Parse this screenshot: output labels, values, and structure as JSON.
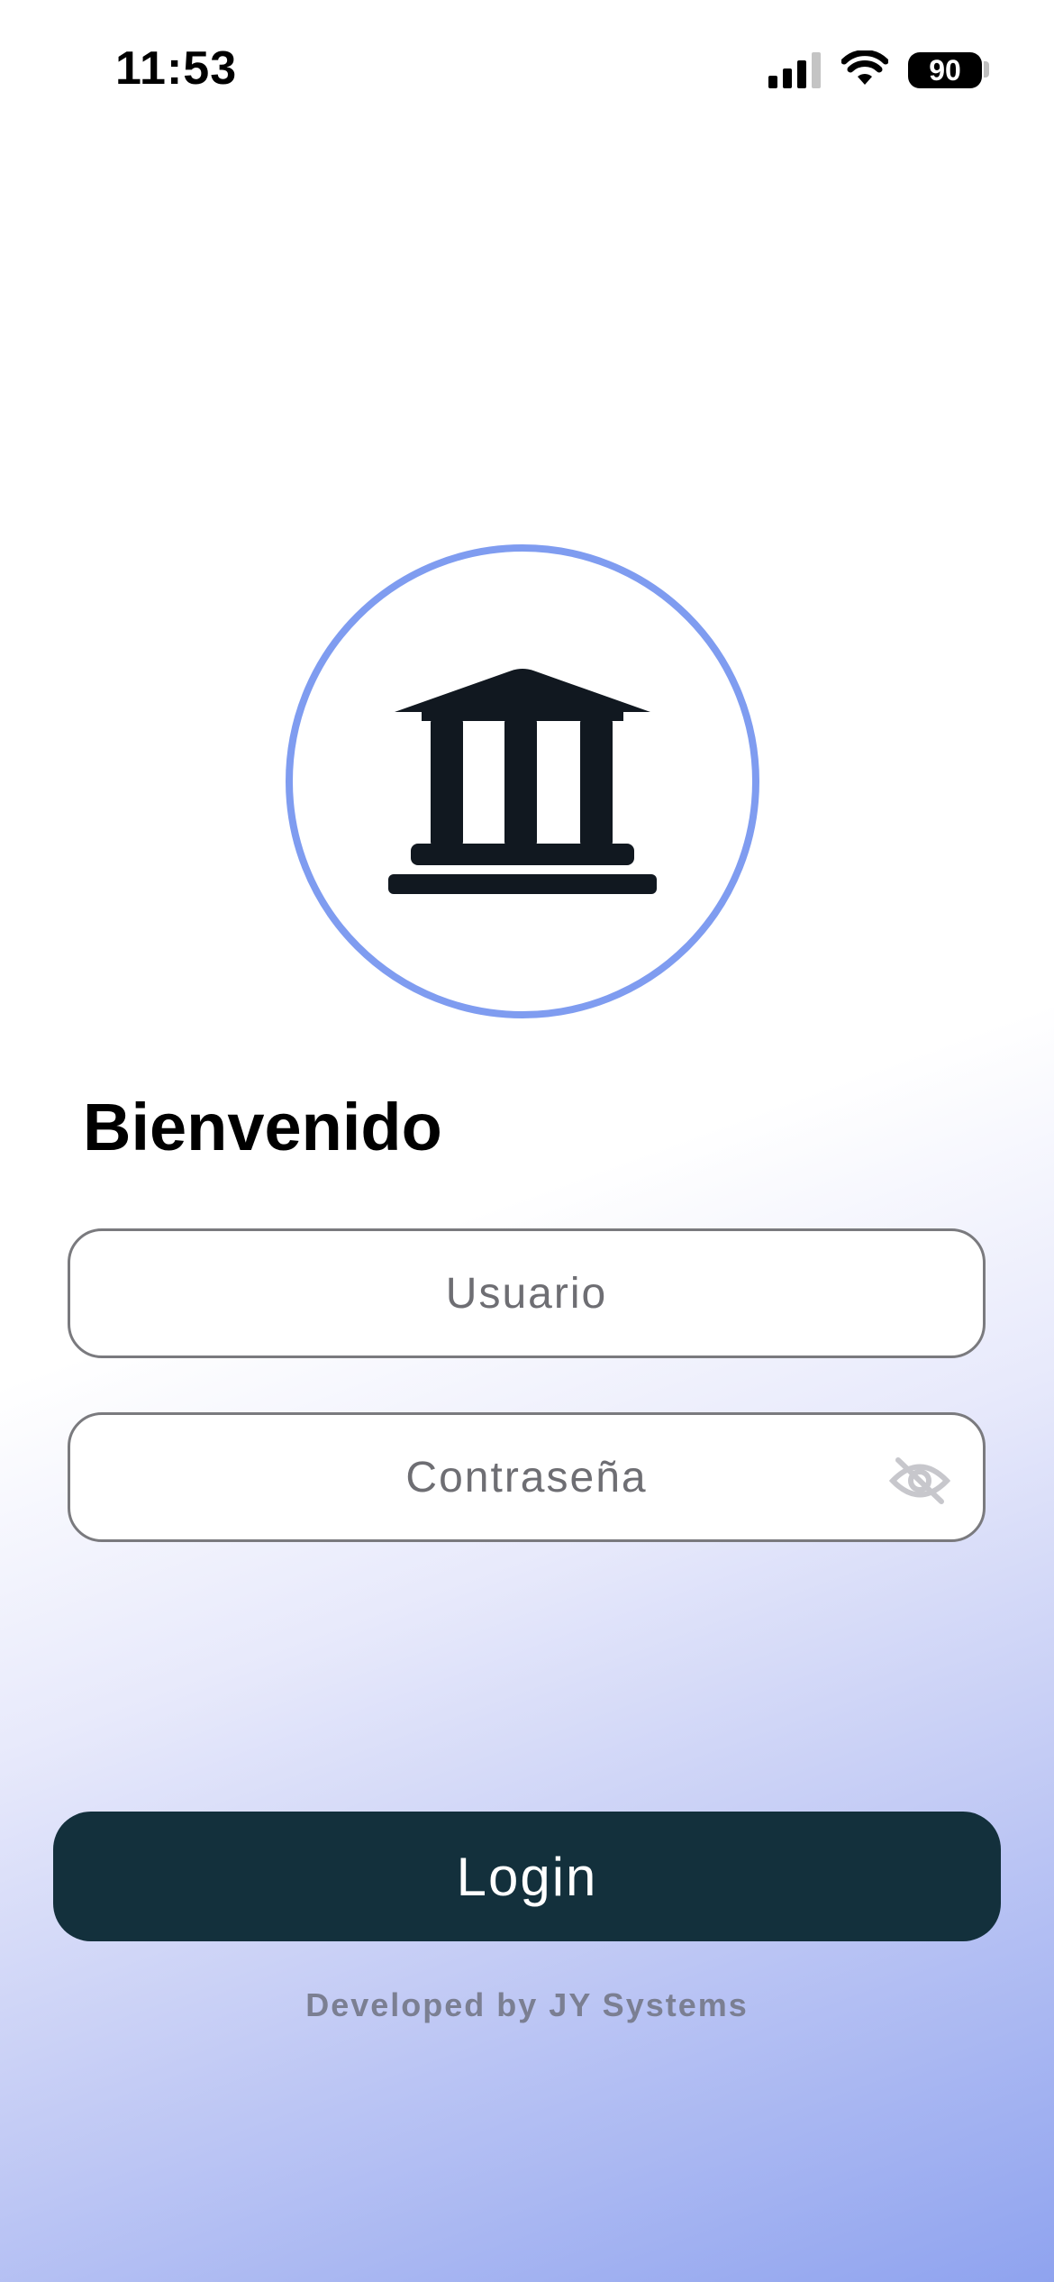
{
  "status_bar": {
    "time": "11:53",
    "battery": "90",
    "icons": [
      "signal-icon",
      "wifi-icon",
      "battery-icon"
    ]
  },
  "logo": {
    "icon": "bank-icon",
    "ring_color": "#7f9cf0"
  },
  "login": {
    "title": "Bienvenido",
    "username_placeholder": "Usuario",
    "username_value": "",
    "password_placeholder": "Contraseña",
    "password_value": "",
    "password_toggle_icon": "eye-off-icon",
    "button_label": "Login"
  },
  "footer": {
    "credit": "Developed by JY Systems"
  },
  "colors": {
    "button_bg": "#13303c",
    "accent": "#7f9cf0",
    "footer_text": "#7b7f92"
  }
}
